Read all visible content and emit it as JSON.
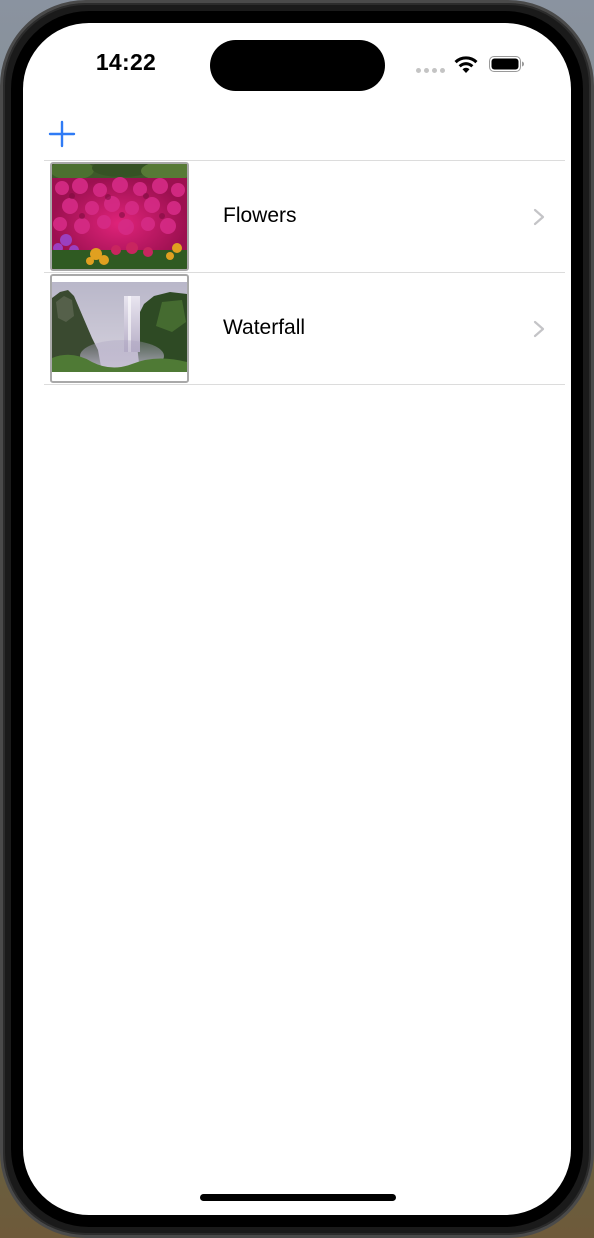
{
  "status_bar": {
    "time": "14:22"
  },
  "nav_bar": {
    "add_icon": "plus-icon"
  },
  "rows": [
    {
      "label": "Flowers",
      "thumbnail": "flowers-photo",
      "accessory": "chevron-right-icon"
    },
    {
      "label": "Waterfall",
      "thumbnail": "waterfall-photo",
      "accessory": "chevron-right-icon"
    }
  ],
  "colors": {
    "tint": "#2f7bf5",
    "separator": "#dcdcdc",
    "chevron": "#c4c4c7"
  }
}
